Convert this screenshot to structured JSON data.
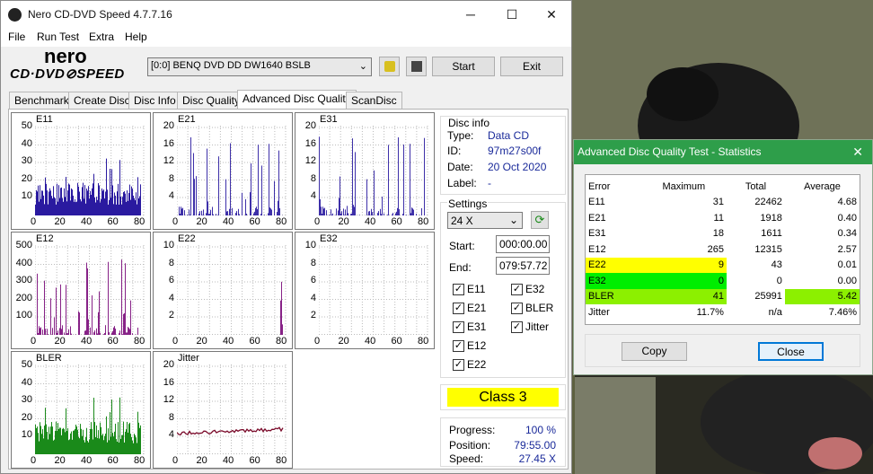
{
  "window": {
    "title": "Nero CD-DVD Speed 4.7.7.16",
    "minimize": "─",
    "maximize": "☐",
    "close": "✕"
  },
  "menu": [
    "File",
    "Run Test",
    "Extra",
    "Help"
  ],
  "logo": {
    "top": "nero",
    "bottom": "CD·DVD⊘SPEED"
  },
  "toolbar": {
    "drive": "[0:0]   BENQ DVD DD DW1640 BSLB",
    "start": "Start",
    "exit": "Exit"
  },
  "tabs": [
    "Benchmark",
    "Create Disc",
    "Disc Info",
    "Disc Quality",
    "Advanced Disc Quality",
    "ScanDisc"
  ],
  "charts": [
    {
      "name": "E11",
      "y": [
        "50",
        "40",
        "30",
        "20",
        "10"
      ],
      "color": "#2a1aa0"
    },
    {
      "name": "E21",
      "y": [
        "20",
        "16",
        "12",
        "8",
        "4"
      ],
      "color": "#2a1aa0"
    },
    {
      "name": "E31",
      "y": [
        "20",
        "16",
        "12",
        "8",
        "4"
      ],
      "color": "#2a1aa0"
    },
    {
      "name": "E12",
      "y": [
        "500",
        "400",
        "300",
        "200",
        "100"
      ],
      "color": "#7a0a7a"
    },
    {
      "name": "E22",
      "y": [
        "10",
        "8",
        "6",
        "4",
        "2"
      ],
      "color": "#7a0a7a"
    },
    {
      "name": "E32",
      "y": [
        "10",
        "8",
        "6",
        "4",
        "2"
      ],
      "color": "#7a0a7a"
    },
    {
      "name": "BLER",
      "y": [
        "50",
        "40",
        "30",
        "20",
        "10"
      ],
      "color": "#1a8a1a"
    },
    {
      "name": "Jitter",
      "y": [
        "20",
        "16",
        "12",
        "8",
        "4"
      ],
      "color": "#7a0a2a"
    }
  ],
  "xticks": [
    "0",
    "20",
    "40",
    "60",
    "80"
  ],
  "disc_info": {
    "header": "Disc info",
    "type_label": "Type:",
    "type": "Data CD",
    "id_label": "ID:",
    "id": "97m27s00f",
    "date_label": "Date:",
    "date": "20 Oct 2020",
    "label_label": "Label:",
    "label": "-"
  },
  "settings": {
    "header": "Settings",
    "speed": "24 X",
    "start_label": "Start:",
    "start": "000:00.00",
    "end_label": "End:",
    "end": "079:57.72"
  },
  "checks": [
    "E11",
    "E32",
    "E21",
    "BLER",
    "E31",
    "Jitter",
    "E12",
    "E22"
  ],
  "class": "Class 3",
  "progress": {
    "progress_label": "Progress:",
    "progress": "100 %",
    "position_label": "Position:",
    "position": "79:55.00",
    "speed_label": "Speed:",
    "speed": "27.45 X"
  },
  "stats": {
    "title": "Advanced Disc Quality Test - Statistics",
    "headers": [
      "Error",
      "Maximum",
      "Total",
      "Average"
    ],
    "rows": [
      [
        "E11",
        "31",
        "22462",
        "4.68"
      ],
      [
        "E21",
        "11",
        "1918",
        "0.40"
      ],
      [
        "E31",
        "18",
        "1611",
        "0.34"
      ],
      [
        "E12",
        "265",
        "12315",
        "2.57"
      ],
      [
        "E22",
        "9",
        "43",
        "0.01"
      ],
      [
        "E32",
        "0",
        "0",
        "0.00"
      ],
      [
        "BLER",
        "41",
        "25991",
        "5.42"
      ],
      [
        "Jitter",
        "11.7%",
        "n/a",
        "7.46%"
      ]
    ],
    "copy": "Copy",
    "close": "Close"
  },
  "colors": {
    "yellow": "#ffff00",
    "green": "#00ee00",
    "lime": "#8cf000",
    "class_bg": "#ffff00"
  }
}
